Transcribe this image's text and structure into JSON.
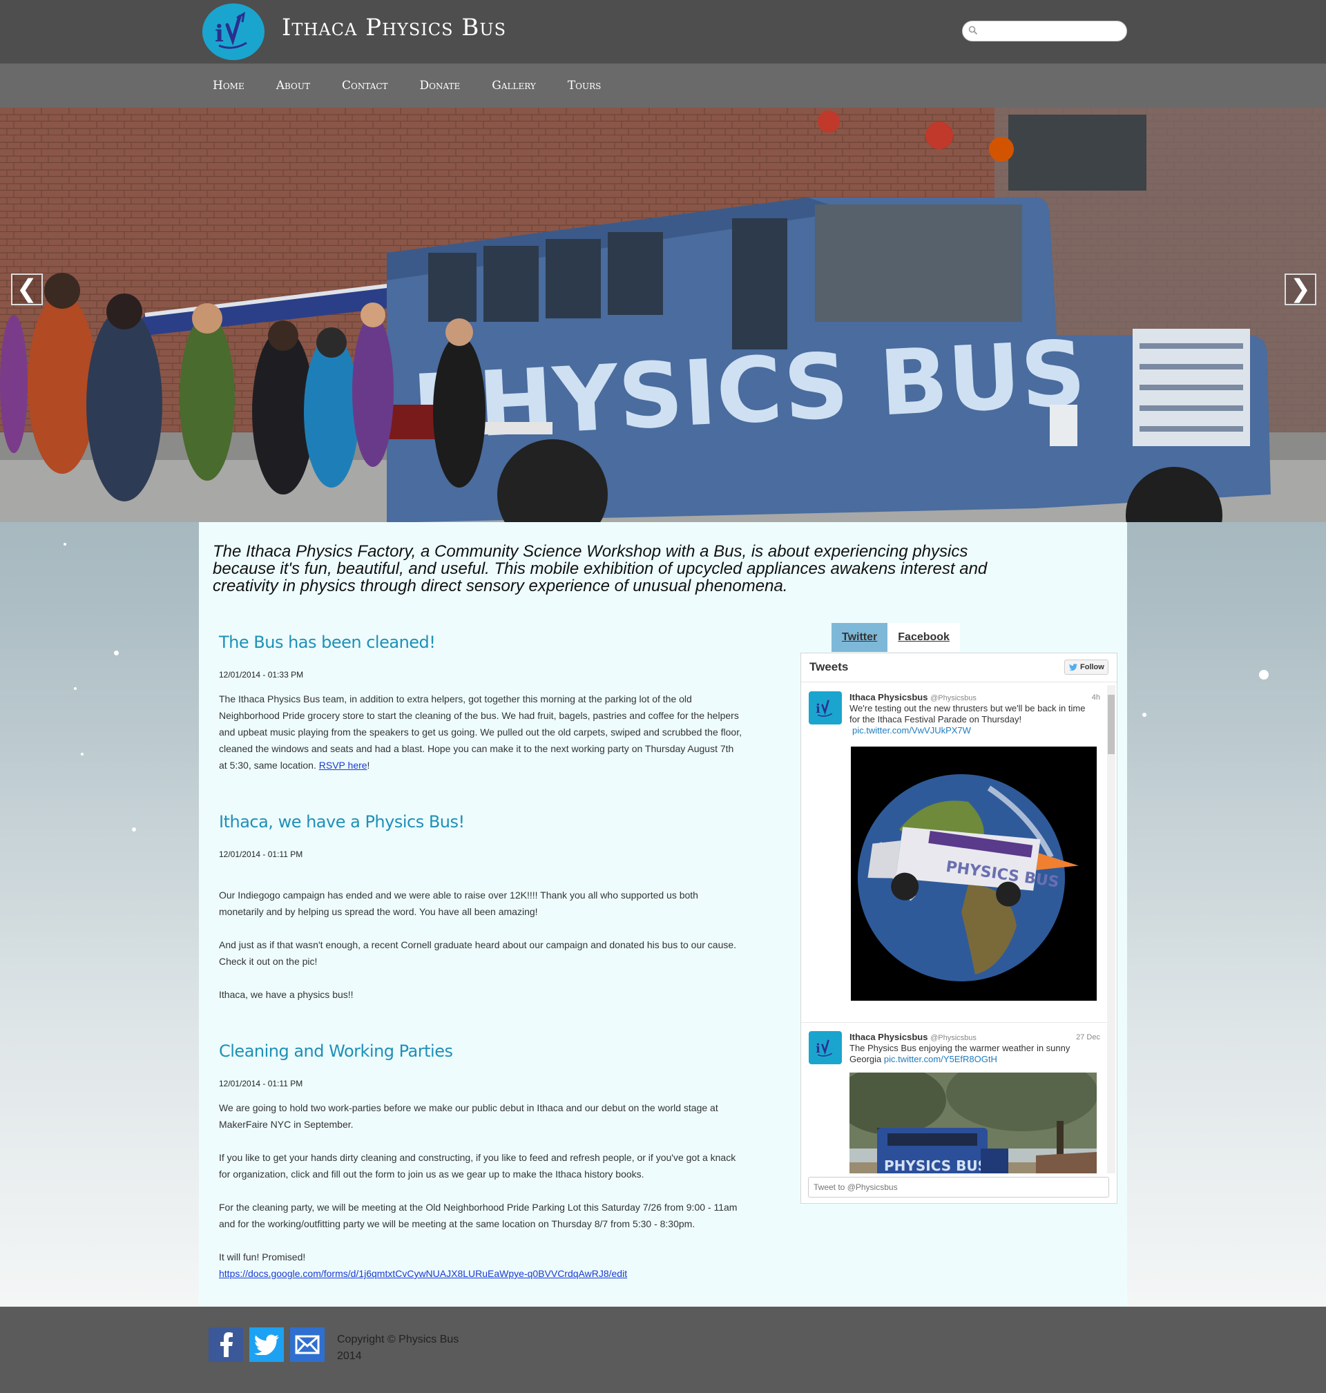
{
  "header": {
    "site_title": "Ithaca Physics Bus",
    "search": {
      "placeholder": "",
      "value": ""
    }
  },
  "nav": {
    "items": [
      "Home",
      "About",
      "Contact",
      "Donate",
      "Gallery",
      "Tours"
    ]
  },
  "hero": {
    "prev_label": "❮",
    "next_label": "❯",
    "bus_lettering": "PHYSICS BUS"
  },
  "intro": "The Ithaca Physics Factory, a Community Science Workshop with a Bus, is about experiencing physics because it's fun, beautiful, and useful. This mobile exhibition of upcycled appliances awakens interest and creativity in physics through direct sensory experience of unusual phenomena.",
  "posts": [
    {
      "title": "The Bus has been cleaned!",
      "date": "12/01/2014 - 01:33 PM",
      "body": "The Ithaca Physics Bus team, in addition to extra helpers, got together this morning at the parking lot of the old Neighborhood Pride grocery store to start the cleaning of the bus. We had fruit, bagels, pastries and coffee for the helpers and upbeat music playing from the speakers to get us going. We pulled out the old carpets, swiped and scrubbed the floor, cleaned the windows and seats and had a blast. Hope you can make it to the next working party on Thursday August 7th at 5:30, same location. ",
      "link": "RSVP here",
      "tail": "!"
    },
    {
      "title": "Ithaca, we have a Physics Bus!",
      "date": "12/01/2014 - 01:11 PM",
      "paragraphs": [
        "Our Indiegogo campaign has ended and we were able to raise over 12K!!!! Thank you all who supported us both monetarily and by helping us spread the word. You have all been amazing!",
        "And just as if that wasn't enough, a recent Cornell graduate heard about our campaign and donated his bus to our cause. Check it out on the pic!",
        "Ithaca, we have a physics bus!!"
      ]
    },
    {
      "title": "Cleaning and Working Parties",
      "date": "12/01/2014 - 01:11 PM",
      "paragraphs": [
        "We are going to hold two work-parties before we make our public debut in Ithaca and our debut on the world stage at MakerFaire NYC in September.",
        "If you like to get your hands dirty cleaning and constructing, if you like to feed and refresh people, or if you've got a knack for organization, click and fill out the form to join us as we gear up to make the Ithaca history books.",
        "For the cleaning party, we will be meeting at the Old Neighborhood Pride Parking Lot this Saturday 7/26 from 9:00 - 11am and for the working/outfitting party we will be meeting at the same location on Thursday 8/7 from 5:30 - 8:30pm.",
        "It will fun! Promised!"
      ],
      "link": "https://docs.google.com/forms/d/1j6qmtxtCvCywNUAJX8LURuEaWpye-q0BVVCrdqAwRJ8/edit"
    }
  ],
  "social_widget": {
    "tabs": [
      "Twitter",
      "Facebook"
    ],
    "active_tab": "Twitter",
    "header": "Tweets",
    "follow_label": "Follow",
    "tweets": [
      {
        "name": "Ithaca Physicsbus",
        "handle": "@Physicsbus",
        "time": "4h",
        "text": "We're testing out the new thrusters but we'll be back in time for the Ithaca Festival Parade on Thursday!",
        "link": "pic.twitter.com/VwVJUkPX7W",
        "image_lettering": "PHYSICS BUS"
      },
      {
        "name": "Ithaca Physicsbus",
        "handle": "@Physicsbus",
        "time": "27 Dec",
        "text": "The Physics Bus enjoying the warmer weather in sunny Georgia ",
        "link": "pic.twitter.com/Y5EfR8OGtH",
        "image_lettering": "PHYSICS BUS"
      }
    ],
    "tweet_placeholder": "Tweet to @Physicsbus"
  },
  "footer": {
    "copyright_line1": "Copyright © Physics Bus",
    "copyright_line2": "2014"
  },
  "colors": {
    "header_bg": "#4e4e4e",
    "nav_bg": "#6a6a6a",
    "accent": "#1e90b8",
    "logo": "#1aa5cf",
    "panel_bg": "#eefcfd",
    "footer_bg": "#5b5b5b"
  }
}
